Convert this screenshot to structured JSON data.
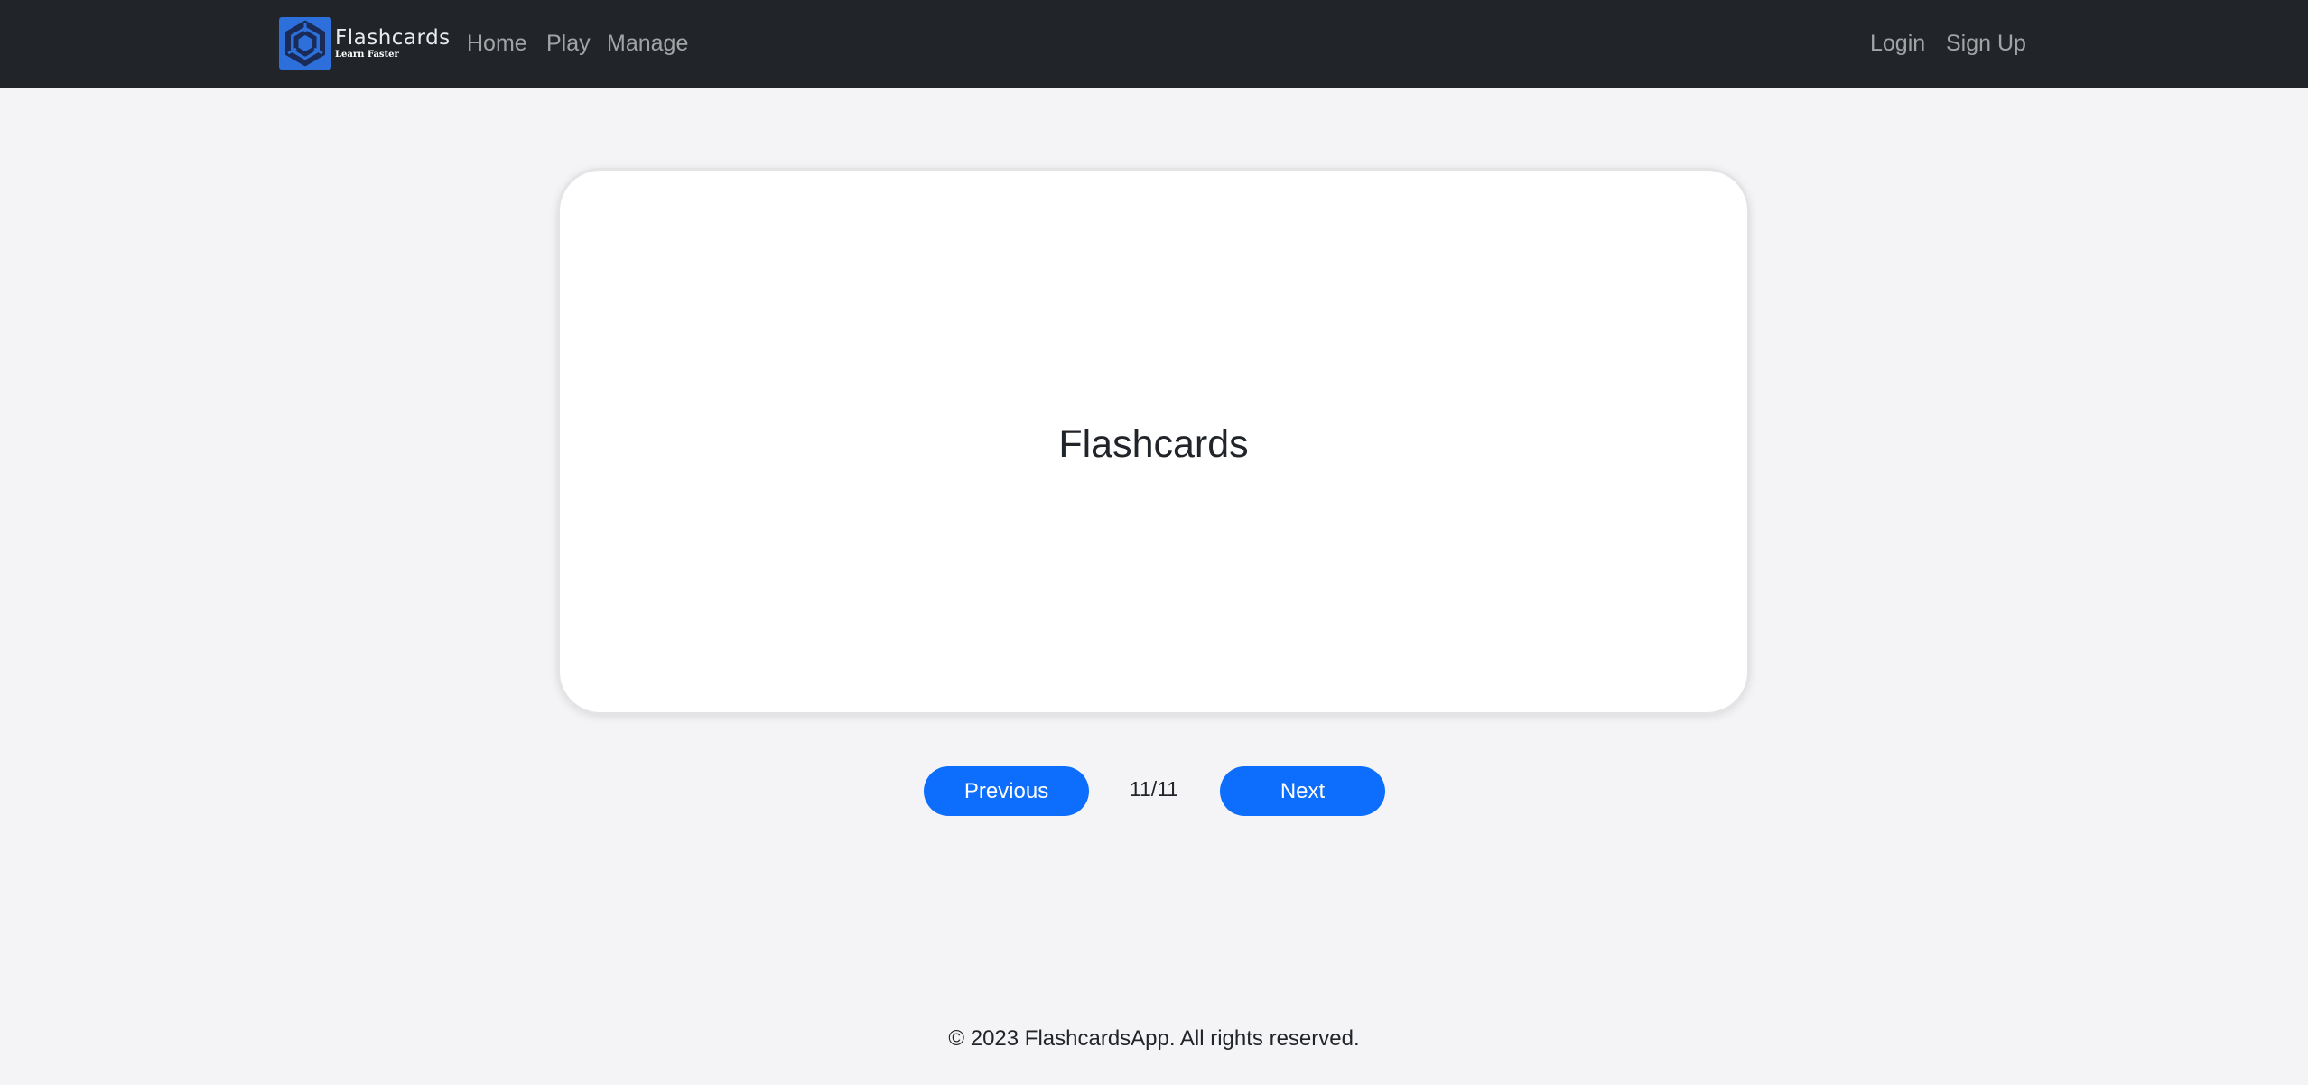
{
  "navbar": {
    "brand": {
      "name": "Flashcards",
      "tagline": "Learn Faster",
      "logo_icon": "hexagon-logo-icon",
      "logo_color": "#2d6fdb"
    },
    "links": [
      {
        "label": "Home"
      },
      {
        "label": "Play"
      },
      {
        "label": "Manage"
      }
    ],
    "auth": {
      "login": "Login",
      "signup": "Sign Up"
    }
  },
  "card": {
    "text": "Flashcards"
  },
  "pagination": {
    "previous_label": "Previous",
    "next_label": "Next",
    "counter": "11/11",
    "current": 11,
    "total": 11,
    "button_color": "#0d6efd"
  },
  "footer": {
    "text": "© 2023 FlashcardsApp. All rights reserved."
  }
}
